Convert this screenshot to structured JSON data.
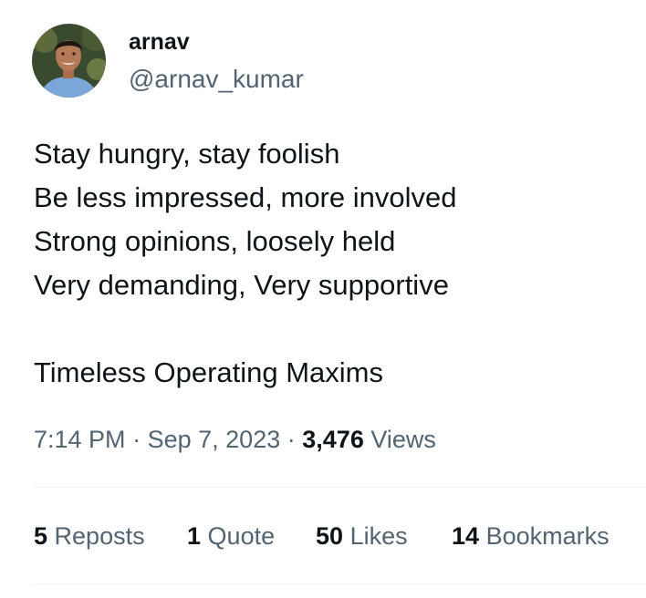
{
  "author": {
    "display_name": "arnav",
    "handle": "@arnav_kumar"
  },
  "tweet": {
    "lines": [
      "Stay hungry, stay foolish",
      "Be less impressed, more involved",
      "Strong opinions, loosely held",
      "Very demanding, Very supportive",
      "",
      "Timeless Operating Maxims"
    ]
  },
  "meta": {
    "time": "7:14 PM",
    "separator": "·",
    "date": "Sep 7, 2023",
    "views_count": "3,476",
    "views_label": "Views"
  },
  "stats": {
    "reposts_count": "5",
    "reposts_label": "Reposts",
    "quotes_count": "1",
    "quotes_label": "Quote",
    "likes_count": "50",
    "likes_label": "Likes",
    "bookmarks_count": "14",
    "bookmarks_label": "Bookmarks"
  },
  "colors": {
    "text_primary": "#0f1419",
    "text_secondary": "#536471",
    "divider": "#eff3f4"
  }
}
